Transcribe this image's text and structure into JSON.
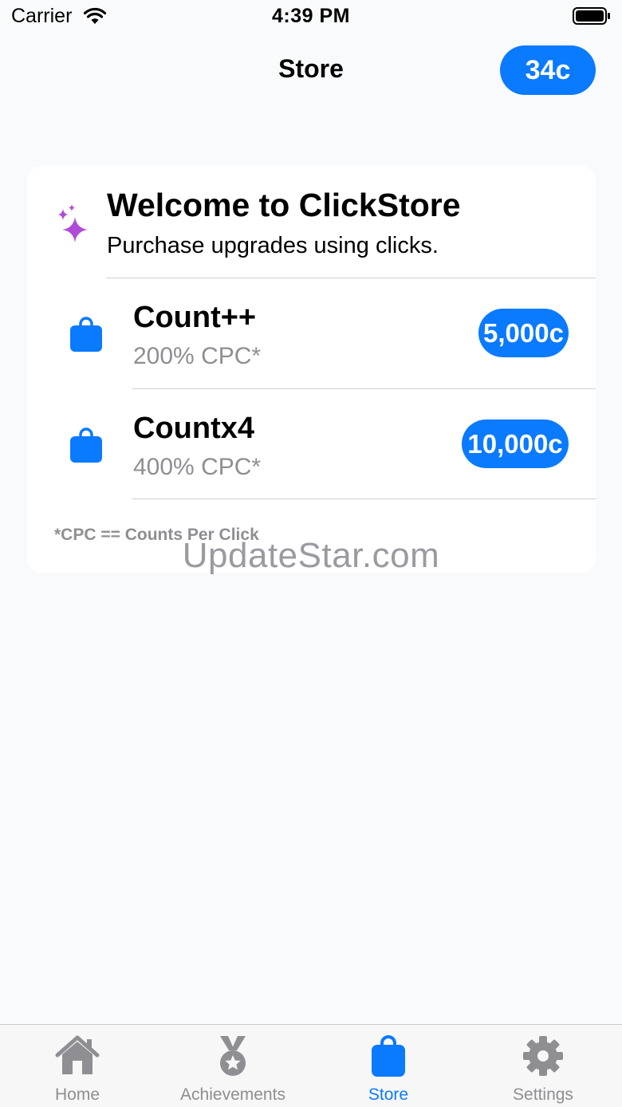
{
  "status_bar": {
    "carrier": "Carrier",
    "time": "4:39 PM"
  },
  "nav": {
    "title": "Store",
    "balance": "34c"
  },
  "welcome": {
    "icon": "sparkles-icon",
    "title": "Welcome to ClickStore",
    "subtitle": "Purchase upgrades using clicks."
  },
  "items": [
    {
      "icon": "shopping-bag-icon",
      "name": "Count++",
      "description": "200% CPC*",
      "price": "5,000c"
    },
    {
      "icon": "shopping-bag-icon",
      "name": "Countx4",
      "description": "400% CPC*",
      "price": "10,000c"
    }
  ],
  "footnote": "*CPC == Counts Per Click",
  "watermark": "UpdateStar.com",
  "tabs": [
    {
      "icon": "house-icon",
      "label": "Home",
      "active": false
    },
    {
      "icon": "medal-icon",
      "label": "Achievements",
      "active": false
    },
    {
      "icon": "shopping-bag-icon",
      "label": "Store",
      "active": true
    },
    {
      "icon": "gear-icon",
      "label": "Settings",
      "active": false
    }
  ],
  "colors": {
    "accent": "#0a7aff",
    "sparkle": "#b04bd8",
    "inactive_tab": "#8e8e93",
    "background": "#f9fafc"
  }
}
